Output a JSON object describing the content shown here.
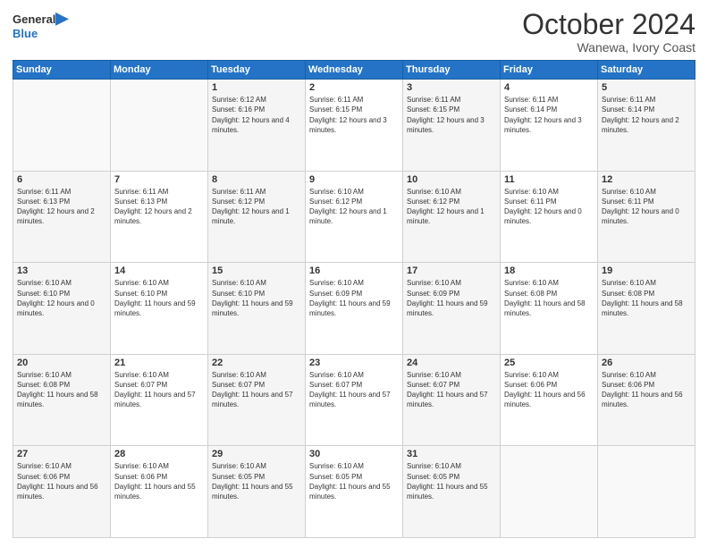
{
  "header": {
    "logo_line1": "General",
    "logo_line2": "Blue",
    "month": "October 2024",
    "location": "Wanewa, Ivory Coast"
  },
  "days_of_week": [
    "Sunday",
    "Monday",
    "Tuesday",
    "Wednesday",
    "Thursday",
    "Friday",
    "Saturday"
  ],
  "weeks": [
    [
      {
        "day": "",
        "sunrise": "",
        "sunset": "",
        "daylight": ""
      },
      {
        "day": "",
        "sunrise": "",
        "sunset": "",
        "daylight": ""
      },
      {
        "day": "1",
        "sunrise": "Sunrise: 6:12 AM",
        "sunset": "Sunset: 6:16 PM",
        "daylight": "Daylight: 12 hours and 4 minutes."
      },
      {
        "day": "2",
        "sunrise": "Sunrise: 6:11 AM",
        "sunset": "Sunset: 6:15 PM",
        "daylight": "Daylight: 12 hours and 3 minutes."
      },
      {
        "day": "3",
        "sunrise": "Sunrise: 6:11 AM",
        "sunset": "Sunset: 6:15 PM",
        "daylight": "Daylight: 12 hours and 3 minutes."
      },
      {
        "day": "4",
        "sunrise": "Sunrise: 6:11 AM",
        "sunset": "Sunset: 6:14 PM",
        "daylight": "Daylight: 12 hours and 3 minutes."
      },
      {
        "day": "5",
        "sunrise": "Sunrise: 6:11 AM",
        "sunset": "Sunset: 6:14 PM",
        "daylight": "Daylight: 12 hours and 2 minutes."
      }
    ],
    [
      {
        "day": "6",
        "sunrise": "Sunrise: 6:11 AM",
        "sunset": "Sunset: 6:13 PM",
        "daylight": "Daylight: 12 hours and 2 minutes."
      },
      {
        "day": "7",
        "sunrise": "Sunrise: 6:11 AM",
        "sunset": "Sunset: 6:13 PM",
        "daylight": "Daylight: 12 hours and 2 minutes."
      },
      {
        "day": "8",
        "sunrise": "Sunrise: 6:11 AM",
        "sunset": "Sunset: 6:12 PM",
        "daylight": "Daylight: 12 hours and 1 minute."
      },
      {
        "day": "9",
        "sunrise": "Sunrise: 6:10 AM",
        "sunset": "Sunset: 6:12 PM",
        "daylight": "Daylight: 12 hours and 1 minute."
      },
      {
        "day": "10",
        "sunrise": "Sunrise: 6:10 AM",
        "sunset": "Sunset: 6:12 PM",
        "daylight": "Daylight: 12 hours and 1 minute."
      },
      {
        "day": "11",
        "sunrise": "Sunrise: 6:10 AM",
        "sunset": "Sunset: 6:11 PM",
        "daylight": "Daylight: 12 hours and 0 minutes."
      },
      {
        "day": "12",
        "sunrise": "Sunrise: 6:10 AM",
        "sunset": "Sunset: 6:11 PM",
        "daylight": "Daylight: 12 hours and 0 minutes."
      }
    ],
    [
      {
        "day": "13",
        "sunrise": "Sunrise: 6:10 AM",
        "sunset": "Sunset: 6:10 PM",
        "daylight": "Daylight: 12 hours and 0 minutes."
      },
      {
        "day": "14",
        "sunrise": "Sunrise: 6:10 AM",
        "sunset": "Sunset: 6:10 PM",
        "daylight": "Daylight: 11 hours and 59 minutes."
      },
      {
        "day": "15",
        "sunrise": "Sunrise: 6:10 AM",
        "sunset": "Sunset: 6:10 PM",
        "daylight": "Daylight: 11 hours and 59 minutes."
      },
      {
        "day": "16",
        "sunrise": "Sunrise: 6:10 AM",
        "sunset": "Sunset: 6:09 PM",
        "daylight": "Daylight: 11 hours and 59 minutes."
      },
      {
        "day": "17",
        "sunrise": "Sunrise: 6:10 AM",
        "sunset": "Sunset: 6:09 PM",
        "daylight": "Daylight: 11 hours and 59 minutes."
      },
      {
        "day": "18",
        "sunrise": "Sunrise: 6:10 AM",
        "sunset": "Sunset: 6:08 PM",
        "daylight": "Daylight: 11 hours and 58 minutes."
      },
      {
        "day": "19",
        "sunrise": "Sunrise: 6:10 AM",
        "sunset": "Sunset: 6:08 PM",
        "daylight": "Daylight: 11 hours and 58 minutes."
      }
    ],
    [
      {
        "day": "20",
        "sunrise": "Sunrise: 6:10 AM",
        "sunset": "Sunset: 6:08 PM",
        "daylight": "Daylight: 11 hours and 58 minutes."
      },
      {
        "day": "21",
        "sunrise": "Sunrise: 6:10 AM",
        "sunset": "Sunset: 6:07 PM",
        "daylight": "Daylight: 11 hours and 57 minutes."
      },
      {
        "day": "22",
        "sunrise": "Sunrise: 6:10 AM",
        "sunset": "Sunset: 6:07 PM",
        "daylight": "Daylight: 11 hours and 57 minutes."
      },
      {
        "day": "23",
        "sunrise": "Sunrise: 6:10 AM",
        "sunset": "Sunset: 6:07 PM",
        "daylight": "Daylight: 11 hours and 57 minutes."
      },
      {
        "day": "24",
        "sunrise": "Sunrise: 6:10 AM",
        "sunset": "Sunset: 6:07 PM",
        "daylight": "Daylight: 11 hours and 57 minutes."
      },
      {
        "day": "25",
        "sunrise": "Sunrise: 6:10 AM",
        "sunset": "Sunset: 6:06 PM",
        "daylight": "Daylight: 11 hours and 56 minutes."
      },
      {
        "day": "26",
        "sunrise": "Sunrise: 6:10 AM",
        "sunset": "Sunset: 6:06 PM",
        "daylight": "Daylight: 11 hours and 56 minutes."
      }
    ],
    [
      {
        "day": "27",
        "sunrise": "Sunrise: 6:10 AM",
        "sunset": "Sunset: 6:06 PM",
        "daylight": "Daylight: 11 hours and 56 minutes."
      },
      {
        "day": "28",
        "sunrise": "Sunrise: 6:10 AM",
        "sunset": "Sunset: 6:06 PM",
        "daylight": "Daylight: 11 hours and 55 minutes."
      },
      {
        "day": "29",
        "sunrise": "Sunrise: 6:10 AM",
        "sunset": "Sunset: 6:05 PM",
        "daylight": "Daylight: 11 hours and 55 minutes."
      },
      {
        "day": "30",
        "sunrise": "Sunrise: 6:10 AM",
        "sunset": "Sunset: 6:05 PM",
        "daylight": "Daylight: 11 hours and 55 minutes."
      },
      {
        "day": "31",
        "sunrise": "Sunrise: 6:10 AM",
        "sunset": "Sunset: 6:05 PM",
        "daylight": "Daylight: 11 hours and 55 minutes."
      },
      {
        "day": "",
        "sunrise": "",
        "sunset": "",
        "daylight": ""
      },
      {
        "day": "",
        "sunrise": "",
        "sunset": "",
        "daylight": ""
      }
    ]
  ]
}
